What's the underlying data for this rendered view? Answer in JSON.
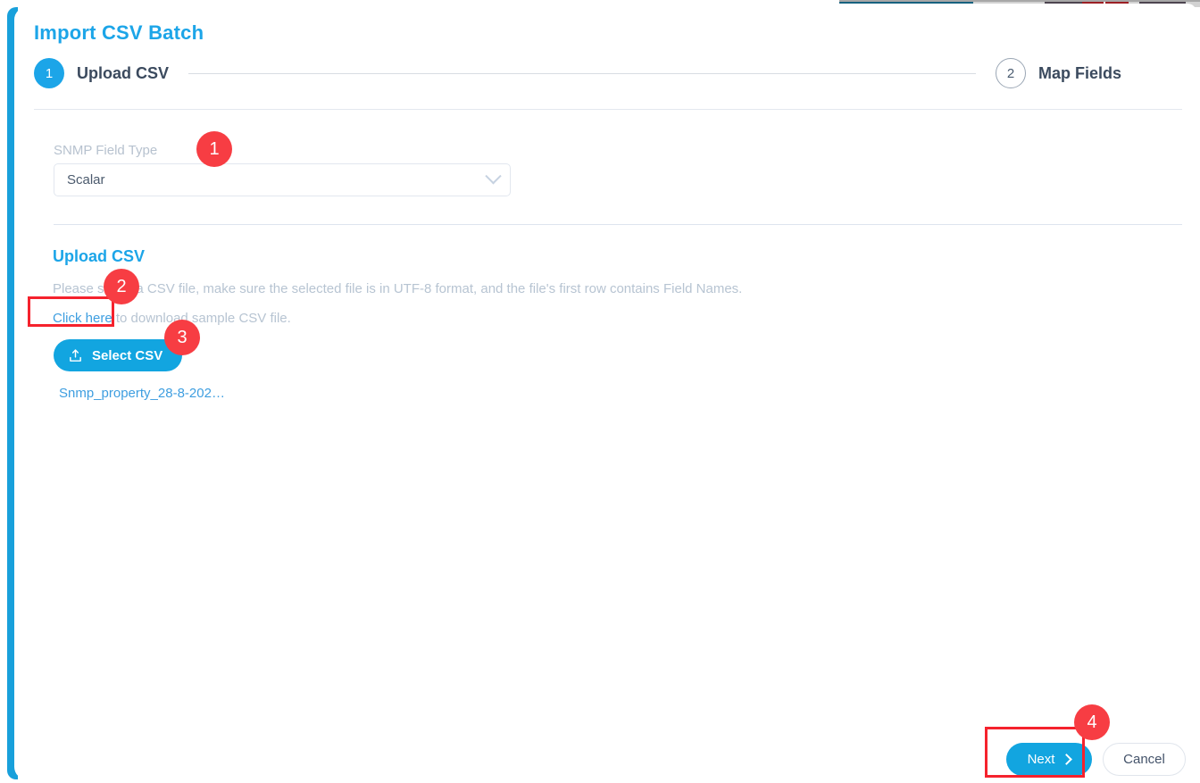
{
  "window": {
    "title": "Import CSV Batch",
    "accent_color": "#18a0db",
    "title_color": "#1ca5e8"
  },
  "stepper": {
    "steps": [
      {
        "number": "1",
        "label": "Upload CSV",
        "state": "active"
      },
      {
        "number": "2",
        "label": "Map Fields",
        "state": "inactive"
      }
    ]
  },
  "form": {
    "snmp_field_type": {
      "label": "SNMP Field Type",
      "value": "Scalar",
      "chevron_icon": "chevron-down-icon"
    }
  },
  "upload": {
    "heading": "Upload CSV",
    "description": "Please select a CSV file, make sure the selected file is in UTF-8 format, and the file's first row contains Field Names.",
    "sample_link_text": "Click here",
    "sample_rest_text": " to download sample CSV file.",
    "select_button_label": "Select CSV",
    "select_button_icon": "upload-icon",
    "selected_file_name": "Snmp_property_28-8-202…"
  },
  "footer": {
    "next_label": "Next",
    "next_icon": "chevron-right-icon",
    "cancel_label": "Cancel"
  },
  "annotations": {
    "badges": [
      {
        "id": "1",
        "label": "1"
      },
      {
        "id": "2",
        "label": "2"
      },
      {
        "id": "3",
        "label": "3"
      },
      {
        "id": "4",
        "label": "4"
      }
    ],
    "highlight_color": "#f5222d",
    "badge_color": "#f73d43"
  }
}
